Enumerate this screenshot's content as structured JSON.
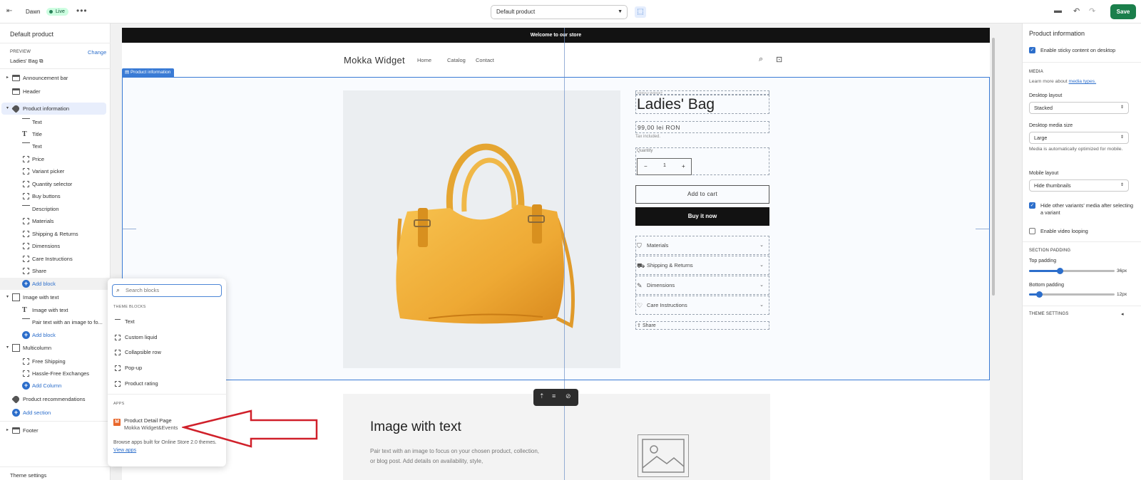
{
  "topbar": {
    "theme_name": "Dawn",
    "live_badge": "Live",
    "template_select": "Default product",
    "save_label": "Save"
  },
  "left_panel": {
    "title": "Default product",
    "preview_label": "PREVIEW",
    "change_label": "Change",
    "preview_value": "Ladies' Bag",
    "tree": [
      {
        "label": "Announcement bar"
      },
      {
        "label": "Header"
      },
      {
        "label": "Product information"
      },
      {
        "label": "Text"
      },
      {
        "label": "Title"
      },
      {
        "label": "Text"
      },
      {
        "label": "Price"
      },
      {
        "label": "Variant picker"
      },
      {
        "label": "Quantity selector"
      },
      {
        "label": "Buy buttons"
      },
      {
        "label": "Description"
      },
      {
        "label": "Materials"
      },
      {
        "label": "Shipping & Returns"
      },
      {
        "label": "Dimensions"
      },
      {
        "label": "Care Instructions"
      },
      {
        "label": "Share"
      },
      {
        "label": "Add block"
      },
      {
        "label": "Image with text"
      },
      {
        "label": "Image with text"
      },
      {
        "label": "Pair text with an image to fo..."
      },
      {
        "label": "Add block"
      },
      {
        "label": "Multicolumn"
      },
      {
        "label": "Free Shipping"
      },
      {
        "label": "Hassle-Free Exchanges"
      },
      {
        "label": "Add Column"
      },
      {
        "label": "Product recommendations"
      },
      {
        "label": "Add section"
      },
      {
        "label": "Footer"
      }
    ],
    "theme_settings": "Theme settings"
  },
  "store": {
    "announcement": "Welcome to our store",
    "brand": "Mokka Widget",
    "nav": [
      "Home",
      "Catalog",
      "Contact"
    ],
    "section_tag": "Product information",
    "product": {
      "vendor": "MOKKA WIDGET",
      "title": "Ladies' Bag",
      "price": "99,00 lei RON",
      "tax_note": "Tax included.",
      "quantity_label": "Quantity",
      "quantity_value": "1",
      "add_to_cart": "Add to cart",
      "buy_now": "Buy it now",
      "collapsibles": [
        "Materials",
        "Shipping & Returns",
        "Dimensions",
        "Care Instructions"
      ],
      "share": "Share"
    },
    "image_with_text": {
      "heading": "Image with text",
      "body": "Pair text with an image to focus on your chosen product, collection, or blog post. Add details on availability, style,"
    }
  },
  "block_popover": {
    "search_placeholder": "Search blocks",
    "theme_blocks_heading": "THEME BLOCKS",
    "theme_blocks": [
      "Text",
      "Custom liquid",
      "Collapsible row",
      "Pop-up",
      "Product rating"
    ],
    "apps_heading": "APPS",
    "app_icon_letter": "M",
    "app_name": "Product Detail Page",
    "app_developer": "Mokka Widget&Events",
    "browse_text": "Browse apps built for Online Store 2.0 themes.",
    "view_apps": "View apps"
  },
  "right_panel": {
    "title": "Product information",
    "sticky_label": "Enable sticky content on desktop",
    "media_heading": "MEDIA",
    "learn_more": "Learn more about",
    "media_types_link": "media types.",
    "desktop_layout_label": "Desktop layout",
    "desktop_layout_value": "Stacked",
    "desktop_media_size_label": "Desktop media size",
    "desktop_media_size_value": "Large",
    "media_note": "Media is automatically optimized for mobile.",
    "mobile_layout_label": "Mobile layout",
    "mobile_layout_value": "Hide thumbnails",
    "hide_variants_label": "Hide other variants' media after selecting a variant",
    "video_looping_label": "Enable video looping",
    "section_padding_heading": "SECTION PADDING",
    "top_padding_label": "Top padding",
    "top_padding_value": "36px",
    "top_padding_fraction": 0.36,
    "bottom_padding_label": "Bottom padding",
    "bottom_padding_value": "12px",
    "bottom_padding_fraction": 0.12,
    "theme_settings": "THEME SETTINGS"
  },
  "colors": {
    "accent_blue": "#2c6ecb",
    "save_green": "#1a7f4b",
    "annotation_red": "#d0202a",
    "bag_yellow": "#f2b33d"
  }
}
